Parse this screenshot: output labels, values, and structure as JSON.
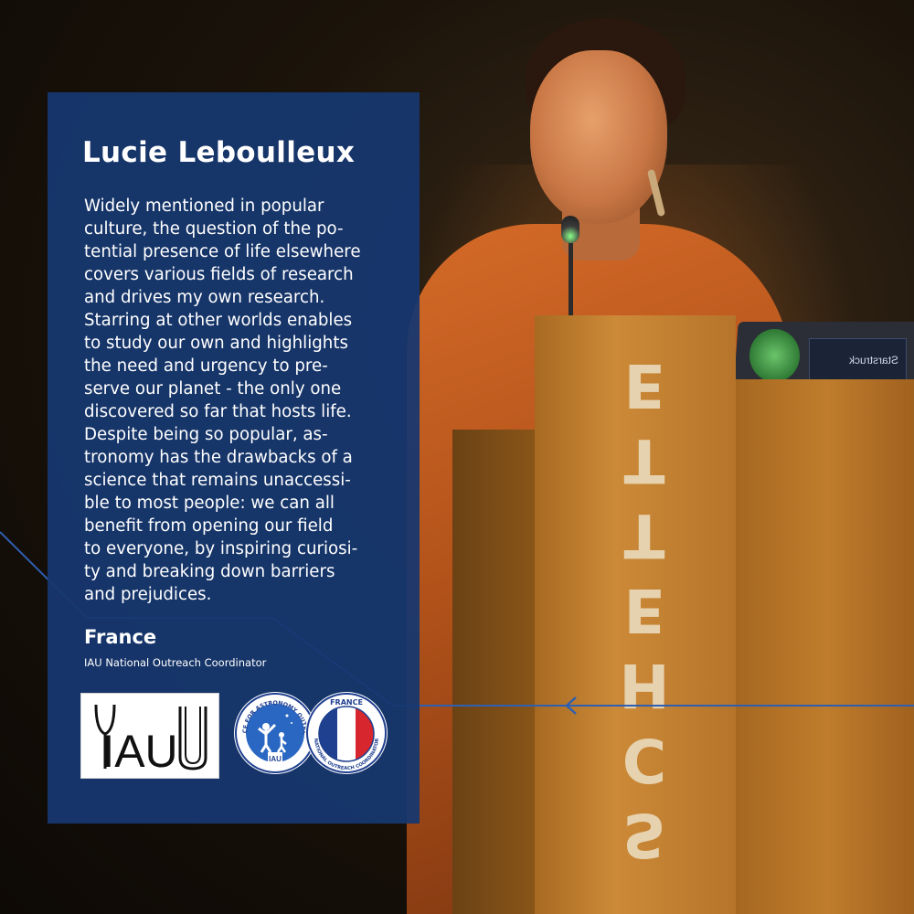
{
  "profile": {
    "name": "Lucie Leboulleux",
    "bio_lines": [
      "Widely mentioned in popular",
      "culture, the question of the po-",
      "tential presence of life elsewhere",
      "covers various fields of research",
      "and drives my own research.",
      "Starring at other worlds enables",
      "to study our own and highlights",
      "the need and urgency to pre-",
      "serve our planet - the only one",
      "discovered so far that hosts life.",
      "Despite being so popular, as-",
      "tronomy has the drawbacks of a",
      "science that remains unaccessi-",
      "ble to most people: we can all",
      "benefit from opening our field",
      "to everyone, by inspiring curiosi-",
      "ty and breaking down barriers",
      "and prejudices."
    ],
    "country": "France",
    "role": "IAU National Outreach Coordinator"
  },
  "logos": {
    "iau_text": "IAU",
    "oao_ring_text": "OFFICE FOR ASTRONOMY OUTREACH",
    "oao_inner_text": "IAU",
    "france_top_text": "FRANCE",
    "france_ring_text": "NATIONAL OUTREACH COORDINATOR"
  },
  "photo": {
    "podium_text": "SCHETTE",
    "sticker_text": "Starstruck"
  },
  "colors": {
    "panel": "#163770",
    "connector": "#2f5fb0",
    "flag_blue": "#1f3f8f",
    "flag_red": "#d8262e"
  }
}
